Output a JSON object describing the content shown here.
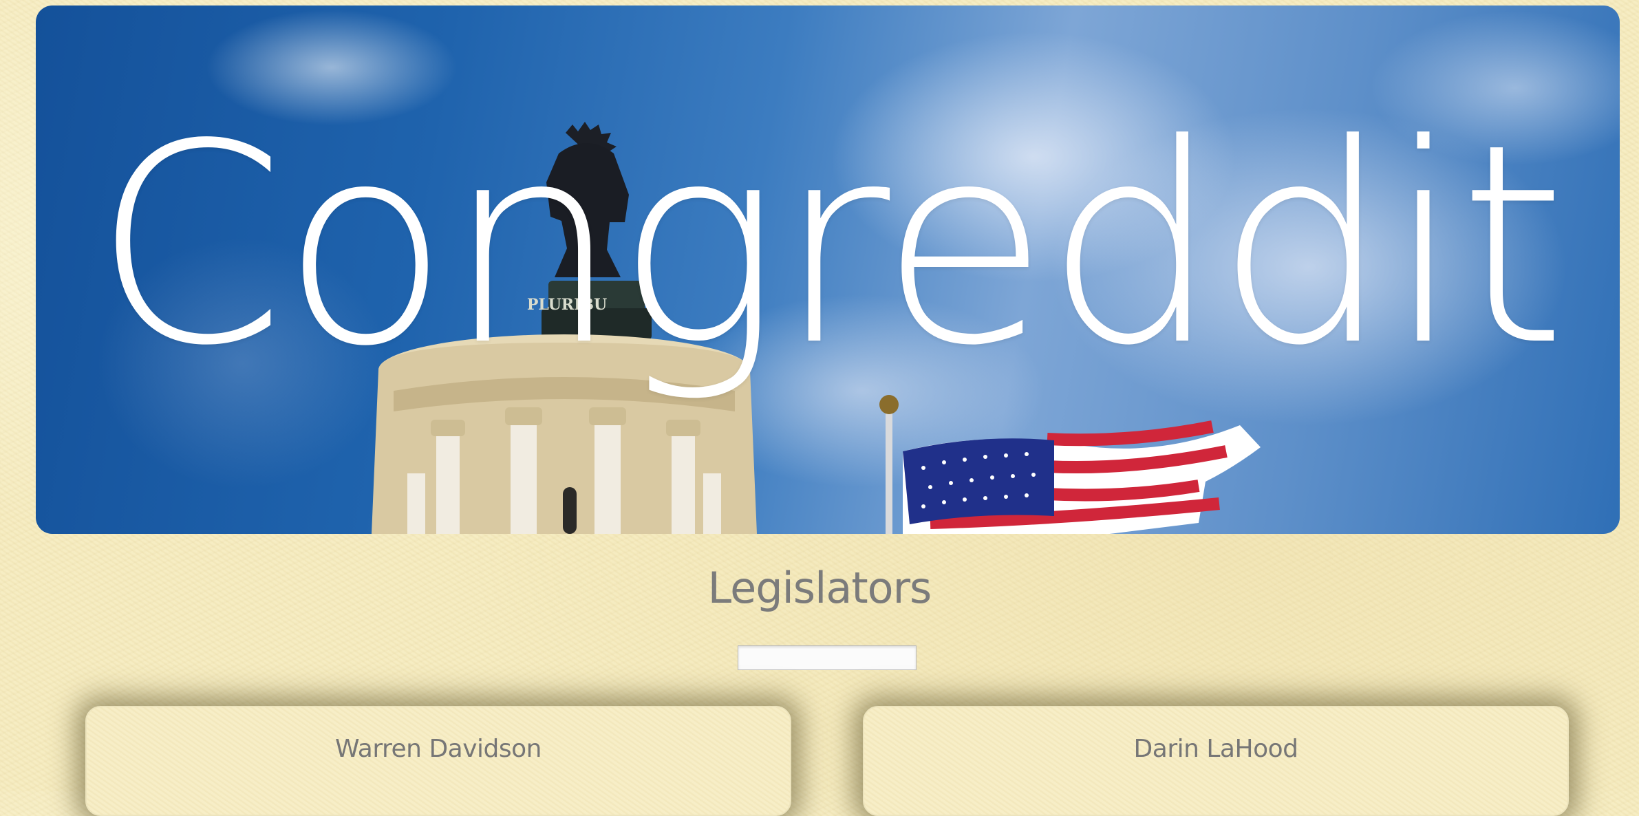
{
  "hero": {
    "title": "Congreddit",
    "statue_inscription": "PLURIBU"
  },
  "section": {
    "title": "Legislators"
  },
  "search": {
    "value": "",
    "placeholder": ""
  },
  "legislators": [
    {
      "name": "Warren Davidson"
    },
    {
      "name": "Darin LaHood"
    }
  ]
}
